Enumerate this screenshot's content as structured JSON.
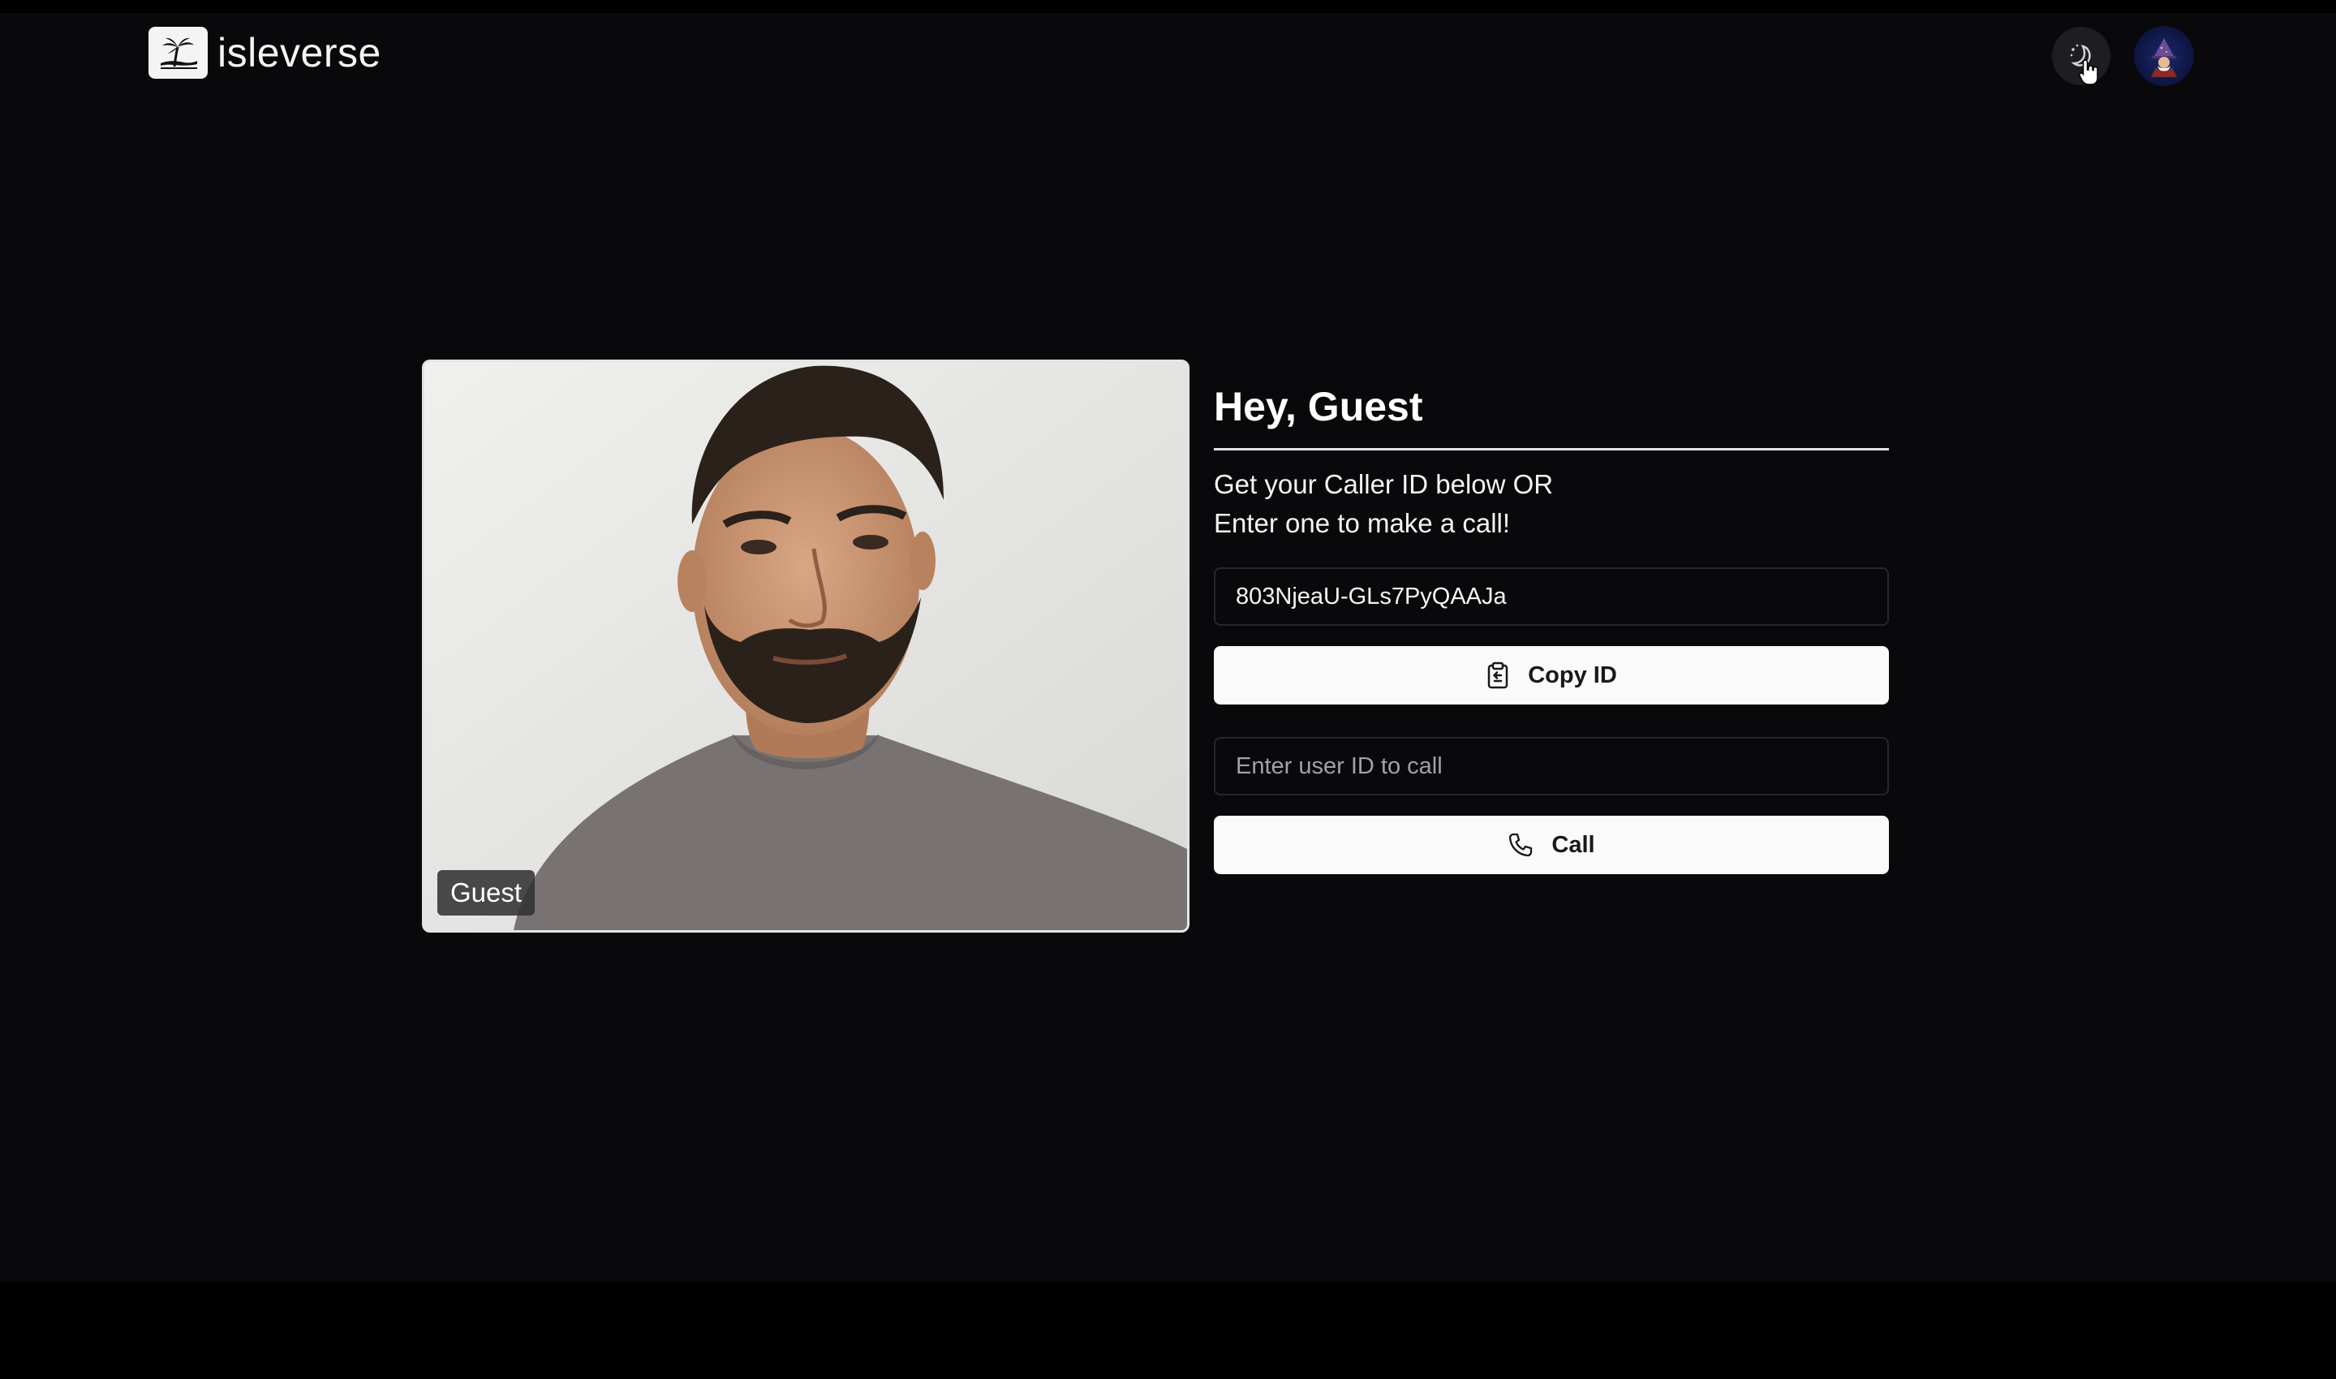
{
  "header": {
    "brand_name": "isleverse",
    "logo_icon": "island-palm-icon",
    "theme_toggle_icon": "moon-stars-icon",
    "avatar_icon": "wizard-avatar"
  },
  "video": {
    "participant_label": "Guest"
  },
  "panel": {
    "greeting": "Hey, Guest",
    "description_line1": "Get your Caller ID below OR",
    "description_line2": "Enter one to make a call!",
    "caller_id_value": "803NjeaU-GLs7PyQAAJa",
    "copy_button_label": "Copy ID",
    "copy_button_icon": "clipboard-icon",
    "call_input_placeholder": "Enter user ID to call",
    "call_button_label": "Call",
    "call_button_icon": "phone-icon"
  },
  "colors": {
    "background": "#09090b",
    "button_background": "#fafafa",
    "button_text": "#18181b",
    "border": "#27272a"
  }
}
